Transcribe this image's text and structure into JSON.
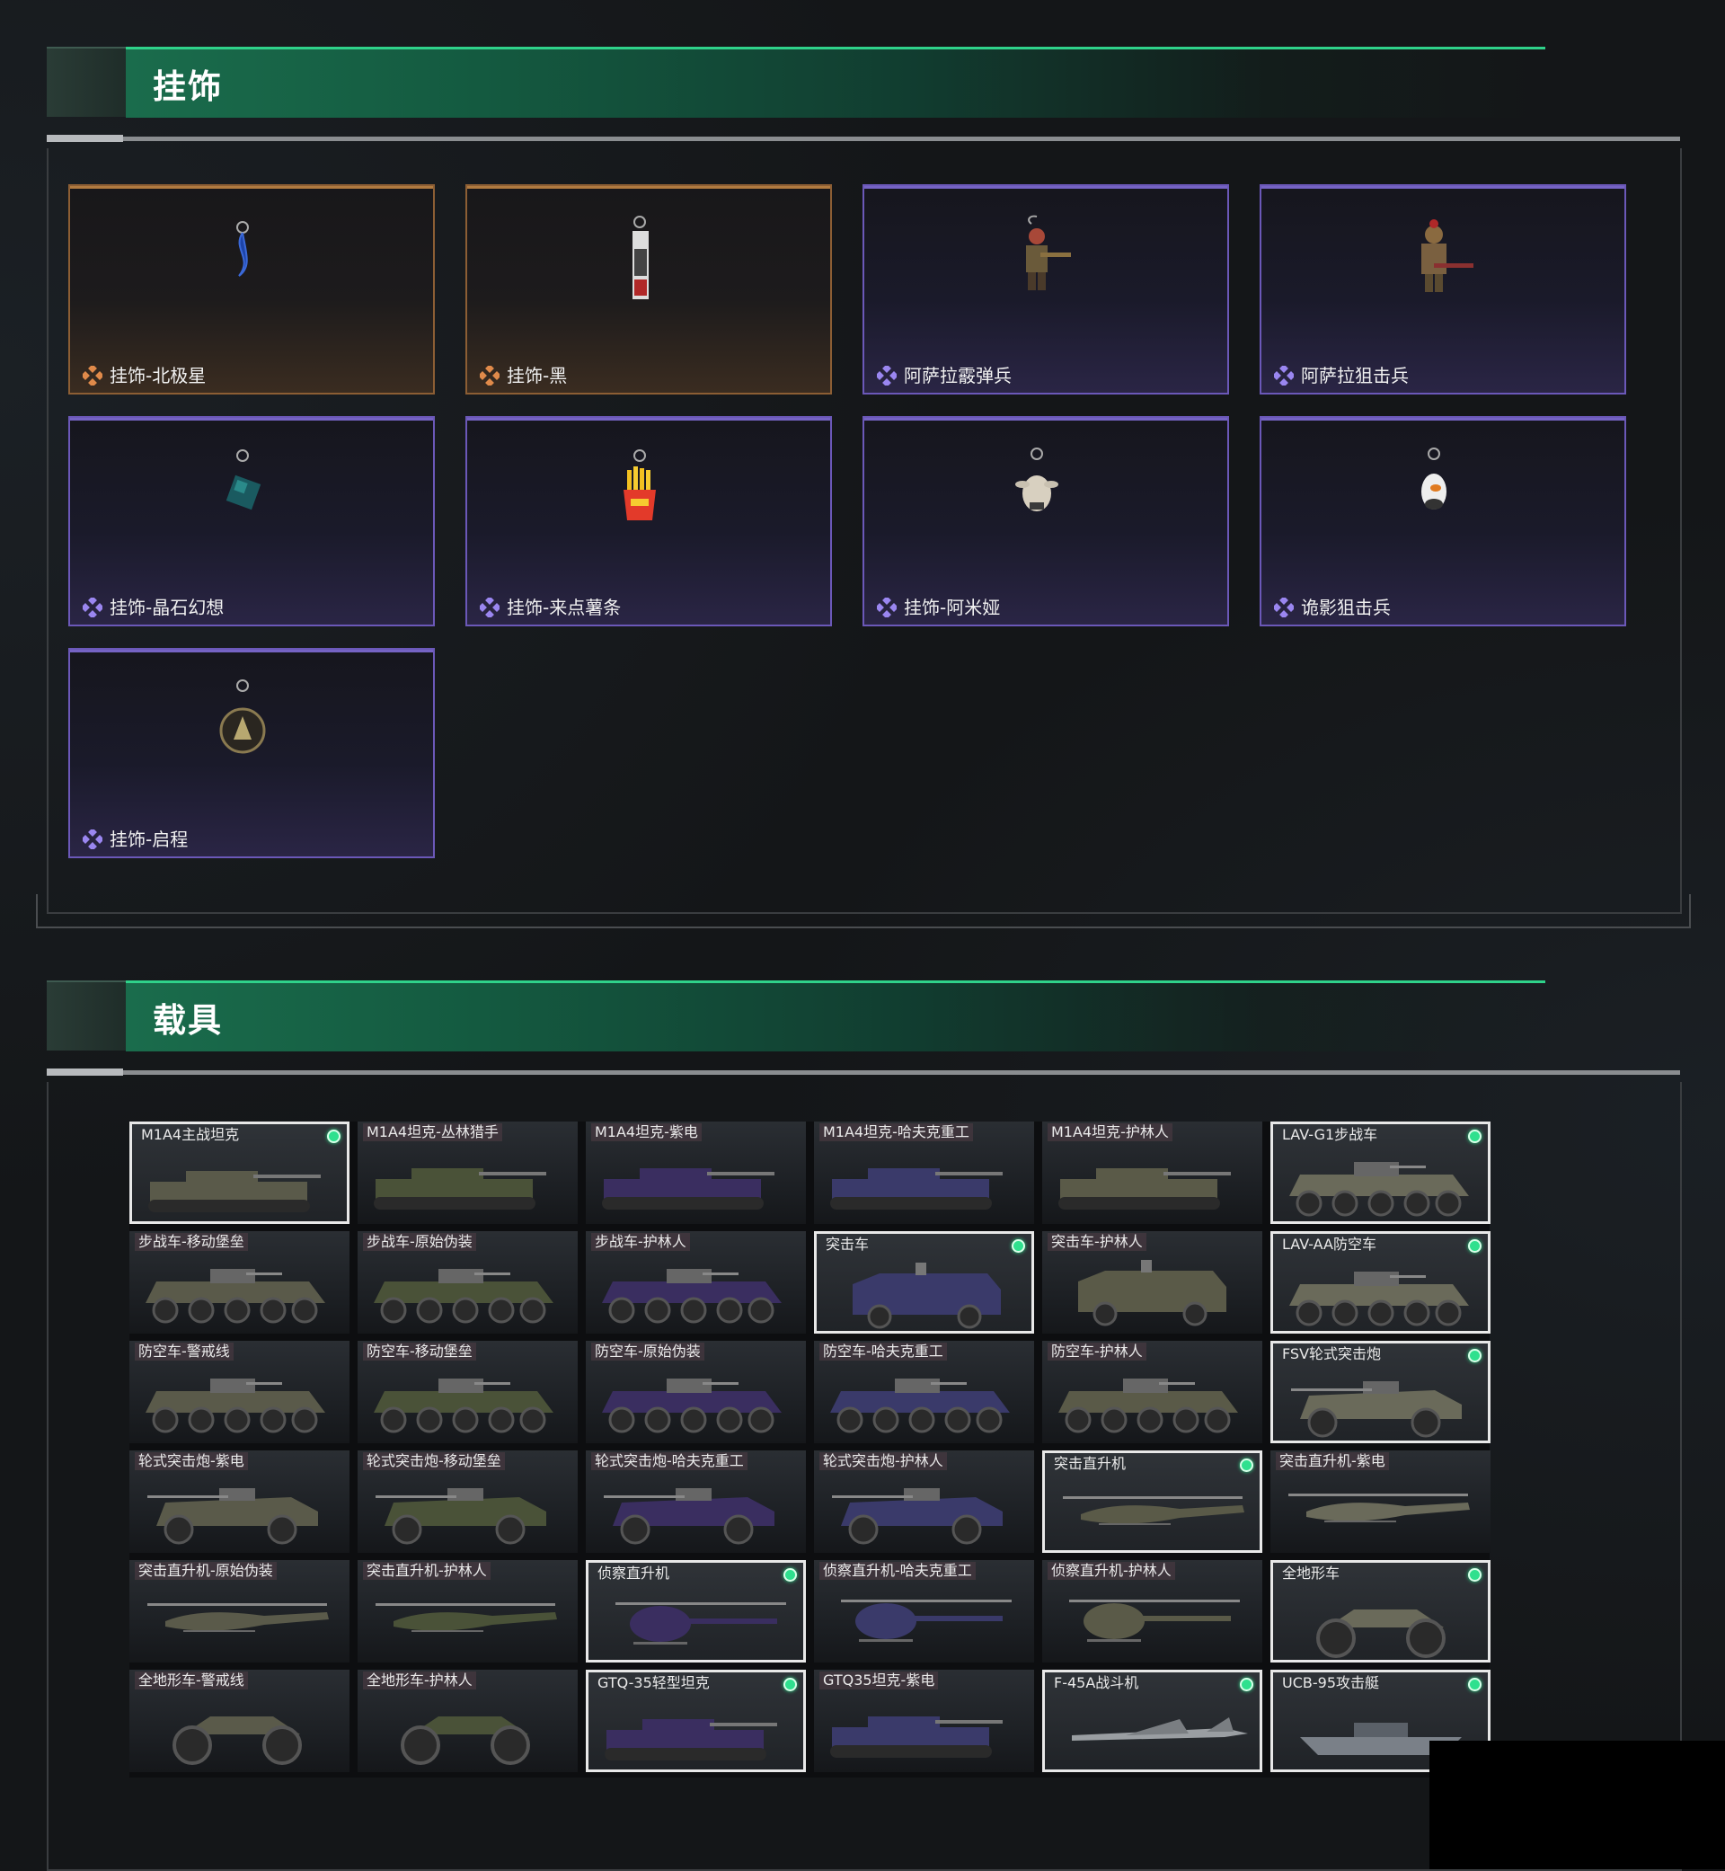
{
  "sections": {
    "charms": {
      "title": "挂饰"
    },
    "vehicles": {
      "title": "载具"
    }
  },
  "colors": {
    "accent_green": "#2fd28a",
    "rarity_orange": "#b07a40",
    "rarity_purple": "#7563c4",
    "owned_dot": "#2fe08e"
  },
  "charms": [
    {
      "name": "挂饰-北极星",
      "rarity": "orange",
      "icon": "keychain-blue-ribbon-icon"
    },
    {
      "name": "挂饰-黑",
      "rarity": "orange",
      "icon": "keychain-tag-icon"
    },
    {
      "name": "阿萨拉霰弹兵",
      "rarity": "purple",
      "icon": "soldier-figure-icon"
    },
    {
      "name": "阿萨拉狙击兵",
      "rarity": "purple",
      "icon": "sniper-figure-icon"
    },
    {
      "name": "挂饰-晶石幻想",
      "rarity": "purple",
      "icon": "keychain-crystal-cube-icon"
    },
    {
      "name": "挂饰-来点薯条",
      "rarity": "purple",
      "icon": "keychain-fries-icon"
    },
    {
      "name": "挂饰-阿米娅",
      "rarity": "purple",
      "icon": "keychain-bunny-icon"
    },
    {
      "name": "诡影狙击兵",
      "rarity": "purple",
      "icon": "keychain-penguin-icon"
    },
    {
      "name": "挂饰-启程",
      "rarity": "purple",
      "icon": "keychain-medal-icon"
    }
  ],
  "vehicles": [
    {
      "name": "M1A4主战坦克",
      "type": "tank",
      "owned": true
    },
    {
      "name": "M1A4坦克-丛林猎手",
      "type": "tank",
      "owned": false
    },
    {
      "name": "M1A4坦克-紫电",
      "type": "tank",
      "owned": false
    },
    {
      "name": "M1A4坦克-哈夫克重工",
      "type": "tank",
      "owned": false
    },
    {
      "name": "M1A4坦克-护林人",
      "type": "tank",
      "owned": false
    },
    {
      "name": "LAV-G1步战车",
      "type": "apc",
      "owned": true
    },
    {
      "name": "步战车-移动堡垒",
      "type": "apc",
      "owned": false
    },
    {
      "name": "步战车-原始伪装",
      "type": "apc",
      "owned": false
    },
    {
      "name": "步战车-护林人",
      "type": "apc",
      "owned": false
    },
    {
      "name": "突击车",
      "type": "mrap",
      "owned": true
    },
    {
      "name": "突击车-护林人",
      "type": "mrap",
      "owned": false
    },
    {
      "name": "LAV-AA防空车",
      "type": "apc",
      "owned": true
    },
    {
      "name": "防空车-警戒线",
      "type": "apc",
      "owned": false
    },
    {
      "name": "防空车-移动堡垒",
      "type": "apc",
      "owned": false
    },
    {
      "name": "防空车-原始伪装",
      "type": "apc",
      "owned": false
    },
    {
      "name": "防空车-哈夫克重工",
      "type": "apc",
      "owned": false
    },
    {
      "name": "防空车-护林人",
      "type": "apc",
      "owned": false
    },
    {
      "name": "FSV轮式突击炮",
      "type": "fsv",
      "owned": true
    },
    {
      "name": "轮式突击炮-紫电",
      "type": "fsv",
      "owned": false
    },
    {
      "name": "轮式突击炮-移动堡垒",
      "type": "fsv",
      "owned": false
    },
    {
      "name": "轮式突击炮-哈夫克重工",
      "type": "fsv",
      "owned": false
    },
    {
      "name": "轮式突击炮-护林人",
      "type": "fsv",
      "owned": false
    },
    {
      "name": "突击直升机",
      "type": "heli",
      "owned": true
    },
    {
      "name": "突击直升机-紫电",
      "type": "heli",
      "owned": false
    },
    {
      "name": "突击直升机-原始伪装",
      "type": "heli",
      "owned": false
    },
    {
      "name": "突击直升机-护林人",
      "type": "heli",
      "owned": false
    },
    {
      "name": "侦察直升机",
      "type": "scout",
      "owned": true
    },
    {
      "name": "侦察直升机-哈夫克重工",
      "type": "scout",
      "owned": false
    },
    {
      "name": "侦察直升机-护林人",
      "type": "scout",
      "owned": false
    },
    {
      "name": "全地形车",
      "type": "atv",
      "owned": true
    },
    {
      "name": "全地形车-警戒线",
      "type": "atv",
      "owned": false
    },
    {
      "name": "全地形车-护林人",
      "type": "atv",
      "owned": false
    },
    {
      "name": "GTQ-35轻型坦克",
      "type": "tank",
      "owned": true
    },
    {
      "name": "GTQ35坦克-紫电",
      "type": "tank",
      "owned": false
    },
    {
      "name": "F-45A战斗机",
      "type": "jet",
      "owned": true
    },
    {
      "name": "UCB-95攻击艇",
      "type": "boat",
      "owned": true
    }
  ]
}
